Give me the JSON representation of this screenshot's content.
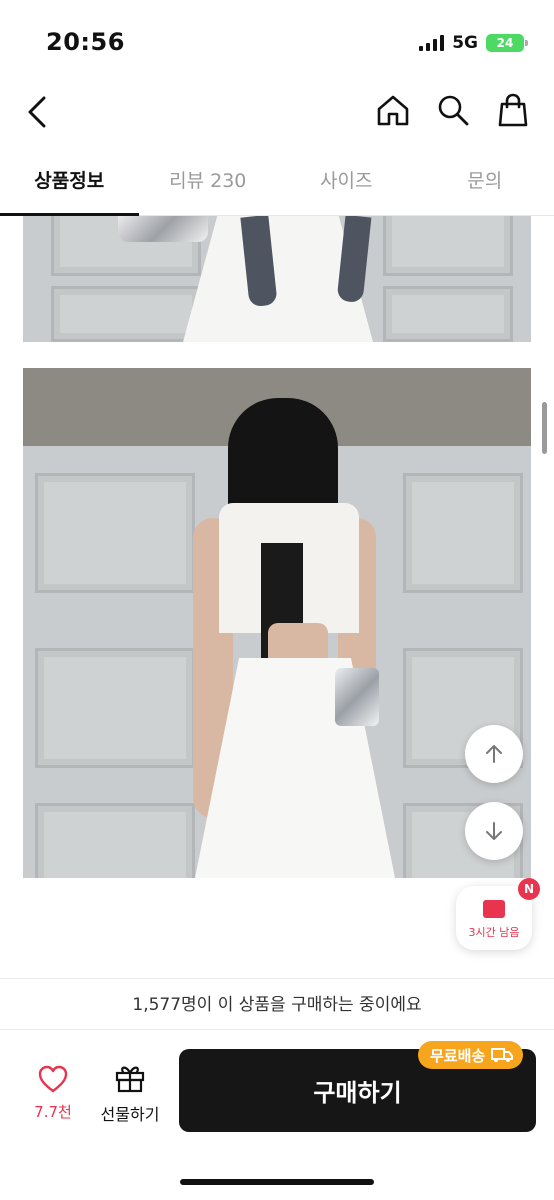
{
  "status_bar": {
    "time": "20:56",
    "network": "5G",
    "battery": "24"
  },
  "nav": {
    "back_icon": "chevron-left-icon",
    "icons": [
      "home-icon",
      "search-icon",
      "shopping-bag-icon"
    ]
  },
  "tabs": [
    {
      "label": "상품정보",
      "active": true
    },
    {
      "label": "리뷰 230",
      "active": false
    },
    {
      "label": "사이즈",
      "active": false
    },
    {
      "label": "문의",
      "active": false
    }
  ],
  "coupon": {
    "badge": "N",
    "text": "3시간 남음"
  },
  "notice": {
    "text": "1,577명이 이 상품을 구매하는 중이에요"
  },
  "bottom_bar": {
    "like_count": "7.7천",
    "gift_label": "선물하기",
    "buy_label": "구매하기",
    "free_shipping_label": "무료배송"
  },
  "colors": {
    "accent": "#e8344e",
    "buy_button": "#161616",
    "free_shipping": "#f7a51c"
  }
}
